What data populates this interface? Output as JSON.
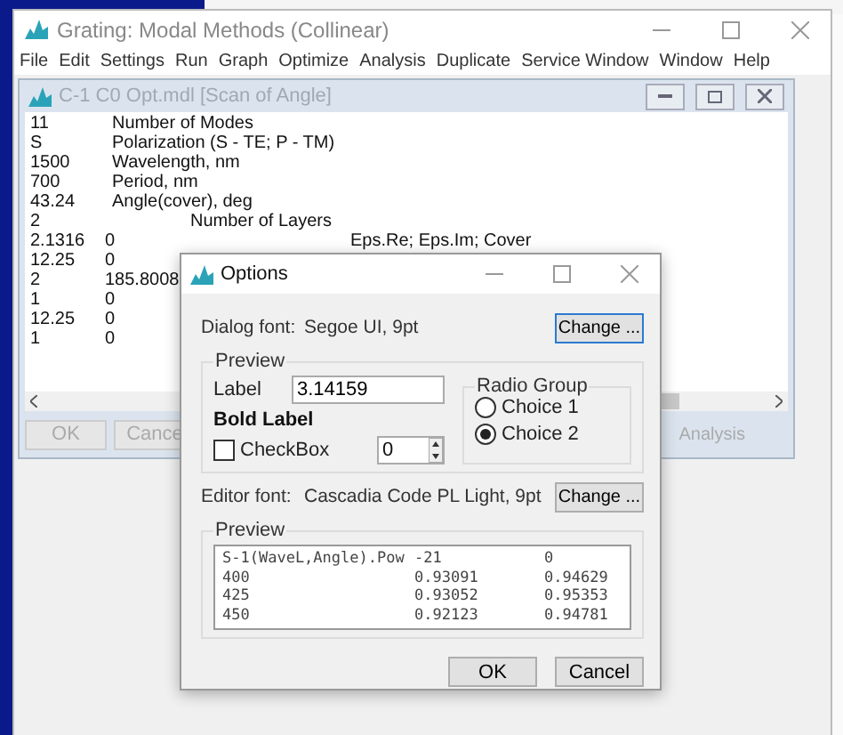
{
  "main_window": {
    "title": "Grating: Modal Methods (Collinear)",
    "menu": [
      "File",
      "Edit",
      "Settings",
      "Run",
      "Graph",
      "Optimize",
      "Analysis",
      "Duplicate",
      "Service Window",
      "Window",
      "Help"
    ]
  },
  "child_window": {
    "title": "C-1 C0 Opt.mdl [Scan of Angle]",
    "rows": [
      {
        "kind": "single",
        "values": [
          "11"
        ],
        "label": "Number of Modes"
      },
      {
        "kind": "single",
        "values": [
          "S"
        ],
        "label": "Polarization (S - TE; P - TM)"
      },
      {
        "kind": "single",
        "values": [
          "1500"
        ],
        "label": "Wavelength, nm"
      },
      {
        "kind": "single",
        "values": [
          "700"
        ],
        "label": "Period, nm"
      },
      {
        "kind": "single",
        "values": [
          "43.24"
        ],
        "label": "Angle(cover), deg"
      },
      {
        "kind": "wide",
        "values": [
          "2"
        ],
        "label": "Number of Layers"
      },
      {
        "kind": "wide",
        "values": [
          "2.1316",
          "0"
        ],
        "label": "Eps.Re; Eps.Im; Cover"
      },
      {
        "kind": "wide",
        "values": [
          "12.25",
          "0"
        ]
      },
      {
        "kind": "wide",
        "values": [
          "2",
          "185.8008"
        ]
      },
      {
        "kind": "wide",
        "values": [
          "1",
          "0"
        ]
      },
      {
        "kind": "wide",
        "values": [
          "12.25",
          "0"
        ]
      },
      {
        "kind": "wide",
        "values": [
          "1",
          "0"
        ]
      }
    ],
    "buttons": [
      {
        "label": "OK",
        "disabled": true
      },
      {
        "label": "Cance",
        "disabled": true
      }
    ],
    "right_button": {
      "label": "Analysis",
      "disabled": true
    }
  },
  "dialog": {
    "title": "Options",
    "dialog_font": {
      "label": "Dialog font:",
      "value": "Segoe UI, 9pt",
      "button": "Change ..."
    },
    "preview_title": "Preview",
    "label_field": {
      "label": "Label",
      "value": "3.14159"
    },
    "bold_label": "Bold Label",
    "checkbox": {
      "label": "CheckBox",
      "checked": false
    },
    "spin_value": "0",
    "radio_group": {
      "title": "Radio Group",
      "options": [
        {
          "label": "Choice 1",
          "selected": false
        },
        {
          "label": "Choice 2",
          "selected": true
        }
      ]
    },
    "editor_font": {
      "label": "Editor font:",
      "value": "Cascadia Code PL Light, 9pt",
      "button": "Change ..."
    },
    "editor_preview": {
      "title": "Preview",
      "lines": [
        [
          "S-1(WaveL,Angle).Pow",
          "-21",
          "0"
        ],
        [
          "400",
          "0.93091",
          "0.94629"
        ],
        [
          "425",
          "0.93052",
          "0.95353"
        ],
        [
          "450",
          "0.92123",
          "0.94781"
        ]
      ]
    },
    "buttons": [
      "OK",
      "Cancel"
    ]
  }
}
